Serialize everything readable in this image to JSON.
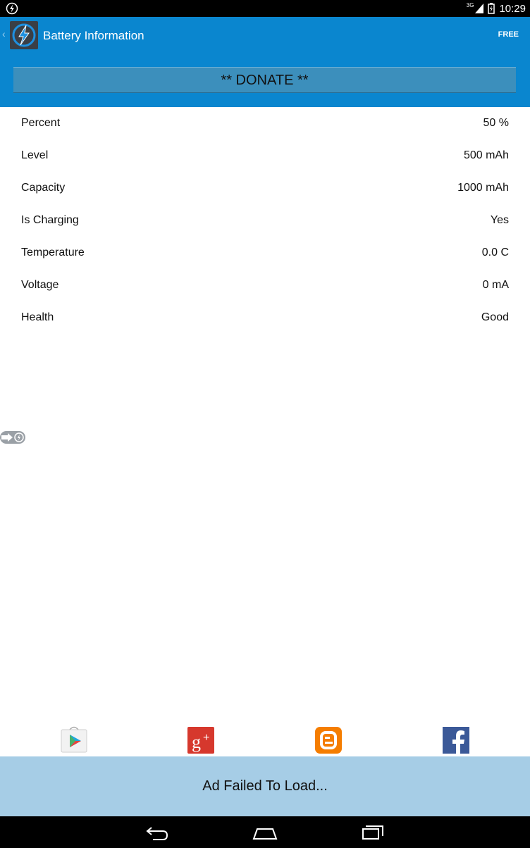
{
  "status_bar": {
    "time": "10:29",
    "network": "3G"
  },
  "app_bar": {
    "title": "Battery Information",
    "free_label": "FREE",
    "donate_label": "** DONATE **"
  },
  "battery": [
    {
      "label": "Percent",
      "value": "50 %"
    },
    {
      "label": "Level",
      "value": "500 mAh"
    },
    {
      "label": "Capacity",
      "value": "1000 mAh"
    },
    {
      "label": "Is Charging",
      "value": "Yes"
    },
    {
      "label": "Temperature",
      "value": "0.0 C"
    },
    {
      "label": "Voltage",
      "value": "0 mA"
    },
    {
      "label": "Health",
      "value": "Good"
    }
  ],
  "social": [
    "google-play-icon",
    "google-plus-icon",
    "blogger-icon",
    "facebook-icon"
  ],
  "ad": {
    "text": "Ad Failed To Load..."
  },
  "colors": {
    "app_bar": "#0a86cf",
    "donate": "#3c8fbc",
    "ad_bar": "#a6cde6"
  }
}
